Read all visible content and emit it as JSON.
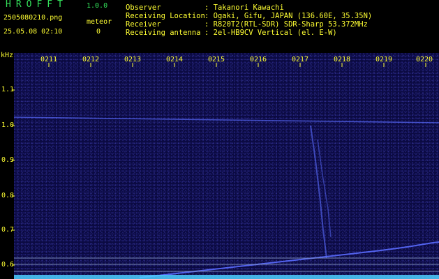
{
  "app": {
    "name": "HROFFT",
    "version": "1.0.0"
  },
  "file": {
    "name": "2505080210.png",
    "timestamp": "25.05.08 02:10"
  },
  "meteor": {
    "label": "meteor",
    "count": "0"
  },
  "info": [
    {
      "key": "Observer",
      "value": ": Takanori Kawachi"
    },
    {
      "key": "Receiving Location",
      "value": ": Ogaki, Gifu, JAPAN (136.60E, 35.35N)"
    },
    {
      "key": "Receiver",
      "value": ": R820T2(RTL-SDR) SDR-Sharp 53.372MHz"
    },
    {
      "key": "Receiving antenna",
      "value": ": 2el-HB9CV Vertical (el. E-W)"
    }
  ],
  "spectrogram": {
    "y_unit": "kHz",
    "x_ticks": [
      "0211",
      "0212",
      "0213",
      "0214",
      "0215",
      "0216",
      "0217",
      "0218",
      "0219",
      "0220"
    ],
    "y_ticks": [
      "1.1",
      "1.0",
      "0.9",
      "0.8",
      "0.7",
      "0.6"
    ],
    "colors": {
      "background": "#0b0a42",
      "signal": "#5a6cff",
      "axis": "#ffff33",
      "header": "#33e05a"
    }
  }
}
